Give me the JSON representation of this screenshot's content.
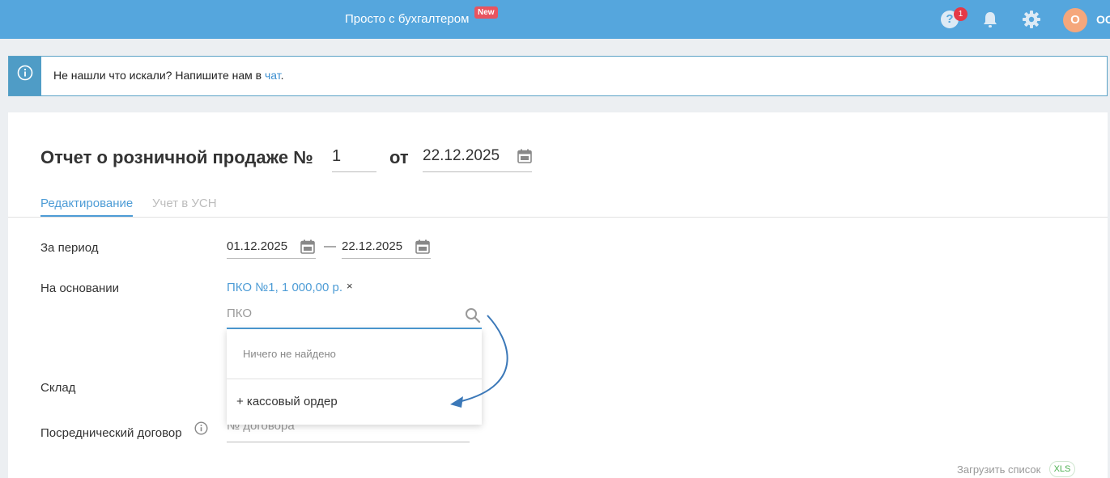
{
  "header": {
    "link_label": "Просто с бухгалтером",
    "new_badge": "New",
    "help_count": "1",
    "avatar_letter": "О",
    "avatar_name": "ОО"
  },
  "banner": {
    "text": "Не нашли что искали? Напишите нам в ",
    "link": "чат",
    "after": "."
  },
  "form": {
    "title": "Отчет о розничной продаже №",
    "number": "1",
    "ot": "от",
    "date": "22.12.2025",
    "tabs": [
      {
        "label": "Редактирование"
      },
      {
        "label": "Учет в УСН"
      }
    ],
    "period_label": "За период",
    "period_from": "01.12.2025",
    "period_dash": "—",
    "period_to": "22.12.2025",
    "basis_label": "На основании",
    "basis_value": "ПКО №1, 1 000,00 р.",
    "basis_remove": "×",
    "search_placeholder": "ПКО",
    "dropdown_empty": "Ничего не найдено",
    "dropdown_add": "+ кассовый ордер",
    "warehouse_label": "Склад",
    "contract_label": "Посреднический договор",
    "contract_placeholder": "№ договора",
    "upload_label": "Загрузить список",
    "xls_badge": "XLS"
  },
  "colors": {
    "header_bg": "#55a6dd",
    "accent": "#4d9cd6",
    "badge_red": "#e8545f"
  }
}
